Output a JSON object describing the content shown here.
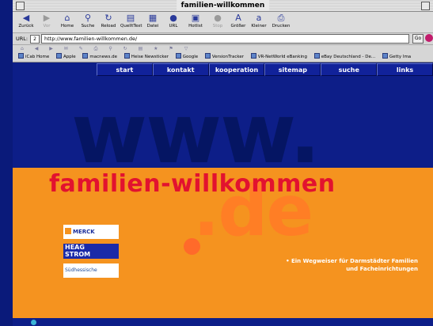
{
  "window": {
    "title": "familien-willkommen"
  },
  "toolbar": {
    "buttons": [
      {
        "label": "Zurück",
        "icon": "back-arrow-icon"
      },
      {
        "label": "Vor",
        "icon": "forward-arrow-icon"
      },
      {
        "label": "Home",
        "icon": "home-icon"
      },
      {
        "label": "Suche",
        "icon": "search-icon"
      },
      {
        "label": "Reload",
        "icon": "reload-icon"
      },
      {
        "label": "QuelltText",
        "icon": "source-icon"
      },
      {
        "label": "Datei",
        "icon": "file-icon"
      },
      {
        "label": "URL",
        "icon": "url-icon"
      },
      {
        "label": "Hotlist",
        "icon": "hotlist-icon"
      },
      {
        "label": "Stop",
        "icon": "stop-icon"
      },
      {
        "label": "Größer",
        "icon": "bigger-font-icon"
      },
      {
        "label": "Kleiner",
        "icon": "smaller-font-icon"
      },
      {
        "label": "Drucken",
        "icon": "print-icon"
      }
    ]
  },
  "urlbar": {
    "label": "URL:",
    "history": "2",
    "url": "http://www.familien-willkommen.de/",
    "go": "Go"
  },
  "bookmarks": [
    "iCab Home",
    "Apple",
    "macnews.de",
    "Heise Newsticker",
    "Google",
    "VersionTracker",
    "VR-NetWorld eBanking",
    "eBay Deutschland - De...",
    "Getty Ima"
  ],
  "nav": [
    "start",
    "kontakt",
    "kooperation",
    "sitemap",
    "suche",
    "links"
  ],
  "hero": {
    "www": "www.",
    "brand": "familien-willkommen",
    "de": ".de"
  },
  "sponsors": {
    "merck": "MERCK",
    "heag_1": "HEAG",
    "heag_2": "STROM",
    "sued": "Südhessische"
  },
  "tagline": {
    "line1": "• Ein Wegweiser für Darmstädter Familien",
    "line2": "und Facheinrichtungen"
  },
  "colors": {
    "navy": "#0d1e88",
    "orange": "#f5931f",
    "red": "#e2122f",
    "light_orange": "#ff7e25"
  }
}
